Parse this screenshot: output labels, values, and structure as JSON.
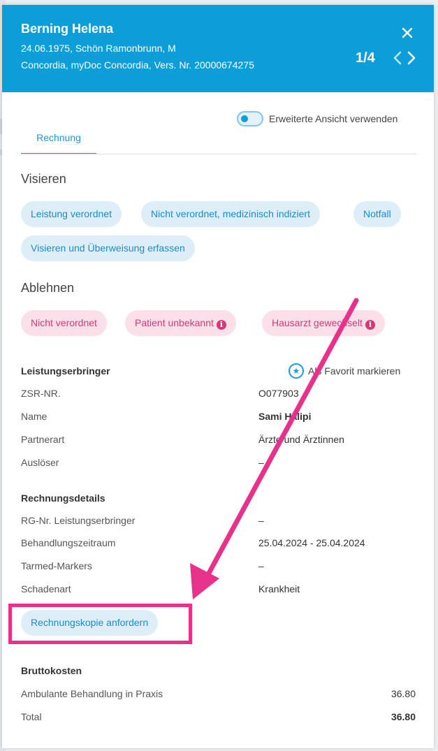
{
  "header": {
    "name": "Berning Helena",
    "line1": "24.06.1975, Schön Ramonbrunn, M",
    "line2": "Concordia, myDoc Concordia, Vers. Nr. 20000674275",
    "pager": "1/4",
    "close_icon": "close-icon",
    "prev_icon": "chevron-left-icon",
    "next_icon": "chevron-right-icon"
  },
  "toggle": {
    "label": "Erweiterte Ansicht verwenden",
    "on": false
  },
  "tabs": [
    {
      "label": "Rechnung",
      "active": true
    }
  ],
  "visieren": {
    "title": "Visieren",
    "chips": [
      "Leistung verordnet",
      "Nicht verordnet, medizinisch indiziert",
      "Notfall",
      "Visieren und Überweisung erfassen"
    ]
  },
  "ablehnen": {
    "title": "Ablehnen",
    "chips": [
      "Nicht verordnet",
      "Patient unbekannt",
      "Hausarzt gewechselt"
    ],
    "info_icon": "info-icon"
  },
  "leistungserbringer": {
    "title": "Leistungserbringer",
    "favorite_label": "Als Favorit markieren",
    "favorite_icon": "star-icon",
    "rows": [
      {
        "label": "ZSR-NR.",
        "value": "O077903"
      },
      {
        "label": "Name",
        "value": "Sami Halipi"
      },
      {
        "label": "Partnerart",
        "value": "Ärzte und Ärztinnen"
      },
      {
        "label": "Auslöser",
        "value": "–"
      }
    ]
  },
  "rechnungsdetails": {
    "title": "Rechnungsdetails",
    "rows": [
      {
        "label": "RG-Nr. Leistungserbringer",
        "value": "–"
      },
      {
        "label": "Behandlungszeitraum",
        "value": "25.04.2024 - 25.04.2024"
      },
      {
        "label": "Tarmed-Markers",
        "value": "–"
      },
      {
        "label": "Schadenart",
        "value": "Krankheit"
      }
    ],
    "copy_button": "Rechnungskopie anfordern"
  },
  "bruttokosten": {
    "title": "Bruttokosten",
    "rows": [
      {
        "label": "Ambulante Behandlung in Praxis",
        "value": "36.80"
      },
      {
        "label": "Total",
        "value": "36.80"
      }
    ]
  },
  "colors": {
    "header": "#0b9ed9",
    "accent": "#1a9bd5",
    "annotation": "#e8318b",
    "pink_chip": "#fbe0ea",
    "blue_chip": "#ddeef7"
  }
}
